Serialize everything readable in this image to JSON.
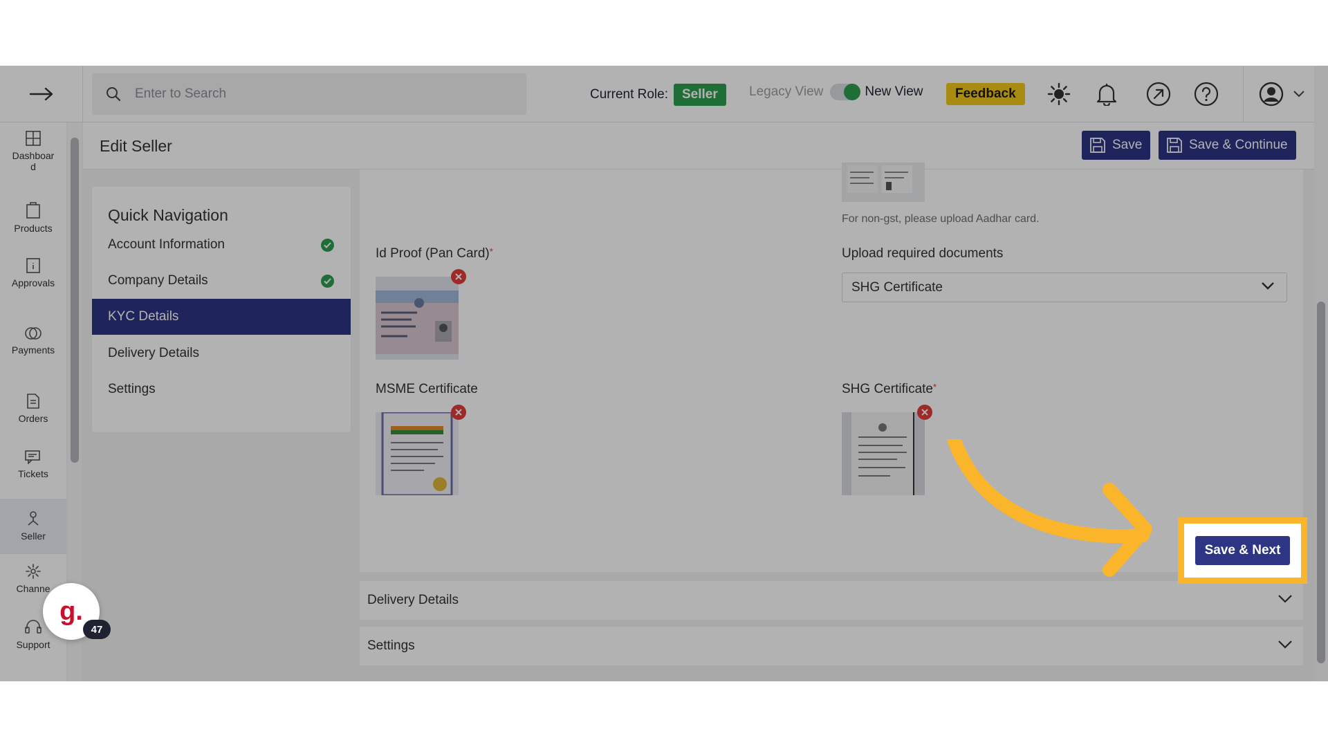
{
  "topbar": {
    "search_placeholder": "Enter to Search",
    "role_label": "Current Role:",
    "role_value": "Seller",
    "legacy_view_label": "Legacy View",
    "new_view_label": "New View",
    "feedback_label": "Feedback"
  },
  "sidebar": {
    "items": [
      {
        "label": "Dashboard",
        "icon": "dashboard-icon"
      },
      {
        "label": "Products",
        "icon": "products-icon"
      },
      {
        "label": "Approvals",
        "icon": "approvals-icon"
      },
      {
        "label": "Payments",
        "icon": "payments-icon"
      },
      {
        "label": "Orders",
        "icon": "orders-icon"
      },
      {
        "label": "Tickets",
        "icon": "tickets-icon"
      },
      {
        "label": "Seller",
        "icon": "seller-icon"
      },
      {
        "label": "Channe",
        "icon": "channels-icon"
      },
      {
        "label": "Support",
        "icon": "support-icon"
      }
    ],
    "badge_letter": "g.",
    "badge_count": "47"
  },
  "header": {
    "title": "Edit Seller",
    "save_label": "Save",
    "save_continue_label": "Save & Continue"
  },
  "quick_nav": {
    "title": "Quick Navigation",
    "items": [
      {
        "label": "Account Information",
        "completed": true
      },
      {
        "label": "Company Details",
        "completed": true
      },
      {
        "label": "KYC Details",
        "completed": false
      },
      {
        "label": "Delivery Details",
        "completed": false
      },
      {
        "label": "Settings",
        "completed": false
      }
    ]
  },
  "kyc": {
    "aadhar_note": "For non-gst, please upload Aadhar card.",
    "id_proof_label": "Id Proof (Pan Card)",
    "upload_docs_label": "Upload required documents",
    "upload_docs_value": "SHG Certificate",
    "msme_label": "MSME Certificate",
    "shg_label": "SHG Certificate",
    "required_mark": "*",
    "save_next_label": "Save & Next"
  },
  "accordions": {
    "delivery": "Delivery Details",
    "settings": "Settings"
  },
  "colors": {
    "brand": "#2d3584",
    "success": "#2f9e4f",
    "feedback": "#f2c71b",
    "highlight": "#fbb52a",
    "danger": "#e23b3b"
  }
}
